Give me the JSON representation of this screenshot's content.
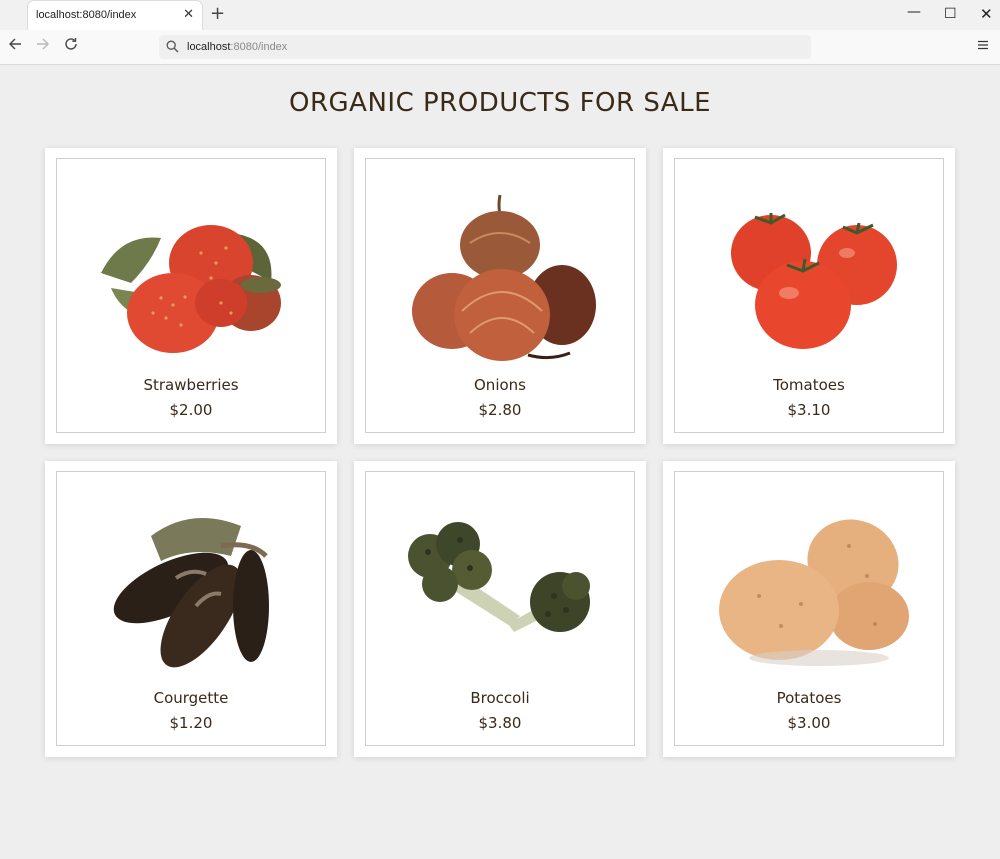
{
  "browser": {
    "tab_title": "localhost:8080/index",
    "tab_close": "✕",
    "new_tab": "+",
    "url_host": "localhost",
    "url_path": ":8080/index",
    "icons": [
      "close-icon",
      "plus-icon",
      "minimize-icon",
      "maximize-icon",
      "window-close-icon",
      "back-arrow-icon",
      "forward-arrow-icon",
      "reload-icon",
      "search-icon",
      "hamburger-menu-icon"
    ]
  },
  "page": {
    "title": "ORGANIC PRODUCTS FOR SALE"
  },
  "products": [
    {
      "name": "Strawberries",
      "price": "$2.00",
      "image": "strawberries-image"
    },
    {
      "name": "Onions",
      "price": "$2.80",
      "image": "onions-image"
    },
    {
      "name": "Tomatoes",
      "price": "$3.10",
      "image": "tomatoes-image"
    },
    {
      "name": "Courgette",
      "price": "$1.20",
      "image": "eggplant-image"
    },
    {
      "name": "Broccoli",
      "price": "$3.80",
      "image": "broccoli-image"
    },
    {
      "name": "Potatoes",
      "price": "$3.00",
      "image": "potatoes-image"
    }
  ],
  "colors": {
    "background": "#eeeeee",
    "text": "#3a2a1a",
    "card": "#ffffff"
  }
}
